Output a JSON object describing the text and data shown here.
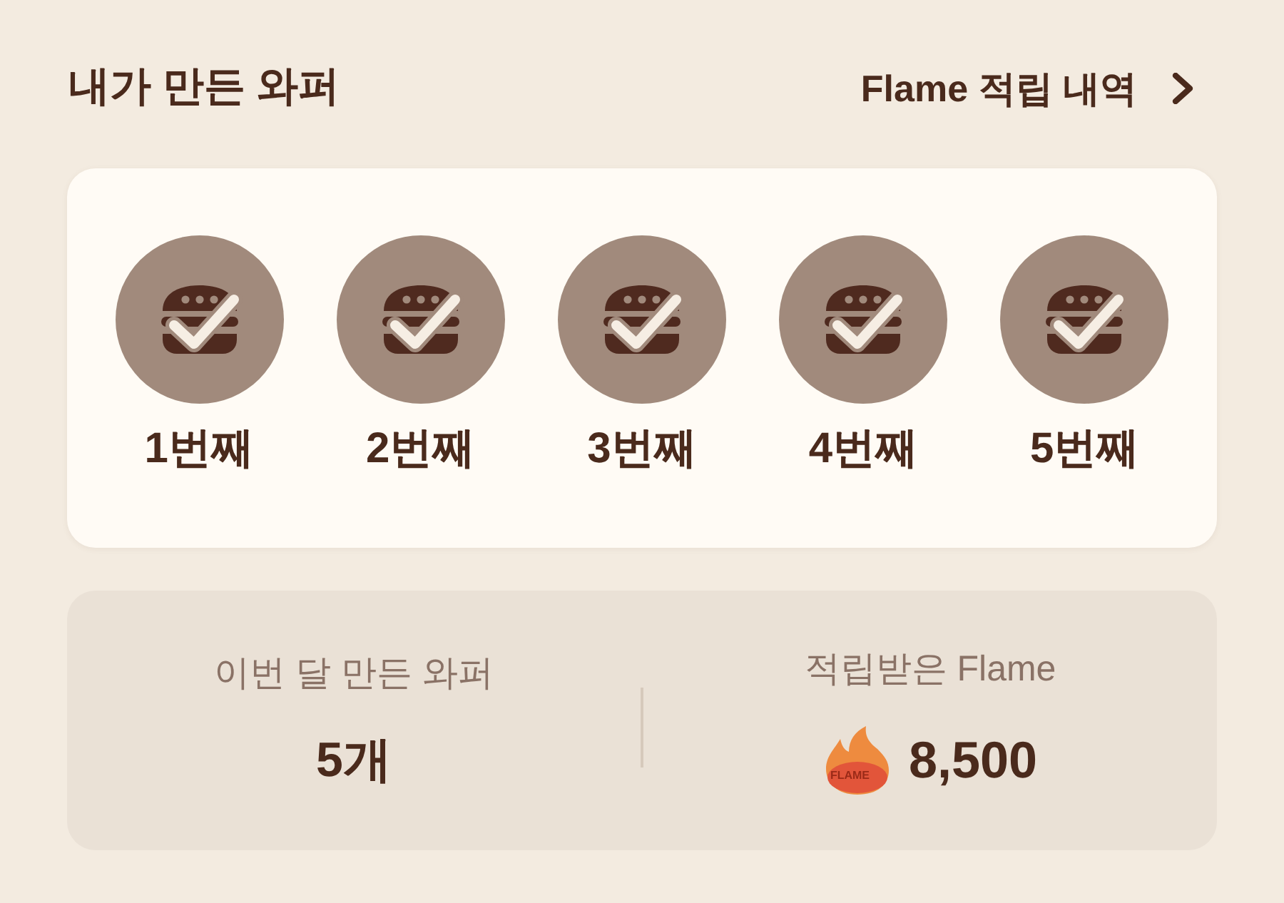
{
  "header": {
    "title": "내가 만든 와퍼",
    "link": "Flame 적립 내역"
  },
  "waffers": [
    {
      "label": "1번째",
      "checked": true
    },
    {
      "label": "2번째",
      "checked": true
    },
    {
      "label": "3번째",
      "checked": true
    },
    {
      "label": "4번째",
      "checked": true
    },
    {
      "label": "5번째",
      "checked": true
    }
  ],
  "stats": [
    {
      "kind": "count",
      "label": "이번 달 만든 와퍼",
      "value": "5개"
    },
    {
      "kind": "flame",
      "label": "적립받은 Flame",
      "value": "8,500",
      "badge": "FLAME"
    }
  ]
}
